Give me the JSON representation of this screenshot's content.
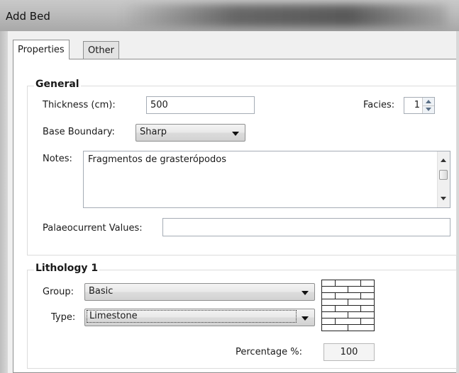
{
  "window": {
    "title": "Add Bed"
  },
  "tabs": [
    {
      "label": "Properties",
      "active": true
    },
    {
      "label": "Other",
      "active": false
    }
  ],
  "general": {
    "title": "General",
    "thickness_label": "Thickness (cm):",
    "thickness_value": "500",
    "facies_label": "Facies:",
    "facies_value": "1",
    "base_boundary_label": "Base Boundary:",
    "base_boundary_value": "Sharp",
    "notes_label": "Notes:",
    "notes_value": "Fragmentos de grasterópodos",
    "palaeocurrent_label": "Palaeocurrent Values:",
    "palaeocurrent_value": ""
  },
  "lithology": {
    "title": "Lithology 1",
    "group_label": "Group:",
    "group_value": "Basic",
    "type_label": "Type:",
    "type_value": "Limestone",
    "pattern_icon": "limestone-brick-pattern-icon",
    "percentage_label": "Percentage %:",
    "percentage_value": "100"
  },
  "colors": {
    "panel_bg": "#ffffff",
    "client_bg": "#f0f0f0",
    "border": "#8e8f8f"
  }
}
